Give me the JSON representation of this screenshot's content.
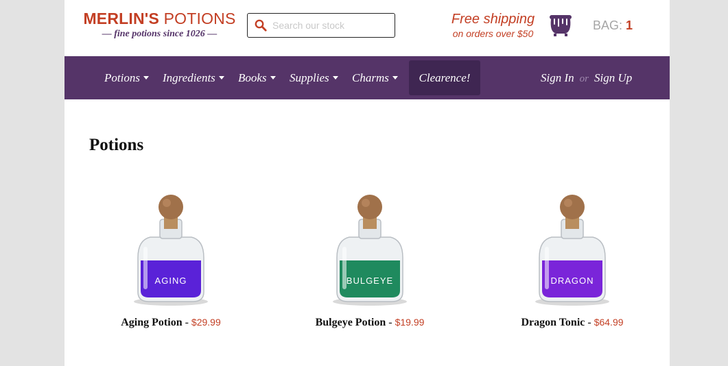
{
  "brand": {
    "name_bold": "MERLIN'S",
    "name_rest": " POTIONS",
    "tagline": "— fine potions since 1026 —"
  },
  "search": {
    "placeholder": "Search our stock",
    "value": ""
  },
  "shipping": {
    "headline": "Free shipping",
    "detail": "on orders over $50"
  },
  "bag": {
    "label": "BAG:",
    "count": "1"
  },
  "nav": {
    "items": [
      {
        "label": "Potions"
      },
      {
        "label": "Ingredients"
      },
      {
        "label": "Books"
      },
      {
        "label": "Supplies"
      },
      {
        "label": "Charms"
      }
    ],
    "clearance": "Clearence!",
    "sign_in": "Sign In",
    "or": "or",
    "sign_up": "Sign Up"
  },
  "page_title": "Potions",
  "products": [
    {
      "name": "Aging Potion",
      "sep": " - ",
      "price": "$29.99",
      "label": "AGING",
      "liquid_color": "#5a22d8"
    },
    {
      "name": "Bulgeye Potion",
      "sep": " - ",
      "price": "$19.99",
      "label": "BULGEYE",
      "liquid_color": "#1f8a5e"
    },
    {
      "name": "Dragon Tonic",
      "sep": " - ",
      "price": "$64.99",
      "label": "DRAGON",
      "liquid_color": "#7a25d9"
    }
  ],
  "colors": {
    "brand_red": "#c33f24",
    "nav_purple": "#553468",
    "clearance_purple": "#3f2652"
  }
}
